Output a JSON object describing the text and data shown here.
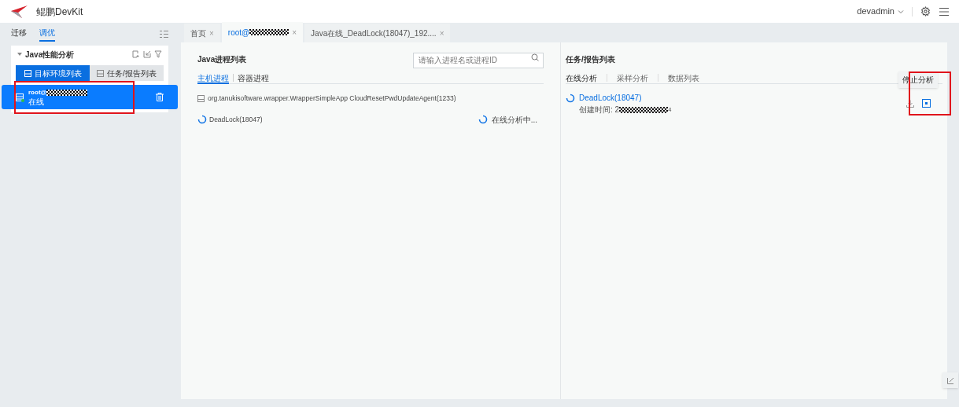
{
  "header": {
    "app_name": "鲲鹏DevKit",
    "user": "devadmin"
  },
  "sidebar": {
    "tabs": [
      {
        "label": "迁移",
        "selected": false
      },
      {
        "label": "调优",
        "selected": true
      }
    ],
    "section": {
      "title": "Java性能分析",
      "expanded": true
    },
    "views": [
      {
        "label": "目标环境列表",
        "selected": true
      },
      {
        "label": "任务/报告列表",
        "selected": false
      }
    ],
    "targets": [
      {
        "name": "root@",
        "status": "在线",
        "online": true,
        "selected": true
      }
    ]
  },
  "tabs": [
    {
      "label": "首页",
      "selected": false,
      "redacted": false,
      "close": "×"
    },
    {
      "label": "root@",
      "selected": true,
      "redacted": true,
      "close": "×"
    },
    {
      "label": "Java在线_DeadLock(18047)_192....",
      "selected": false,
      "redacted": false,
      "close": "×"
    }
  ],
  "process_panel": {
    "title": "Java进程列表",
    "search": {
      "placeholder": "请输入进程名或进程ID"
    },
    "tabs": [
      {
        "label": "主机进程",
        "selected": true
      },
      {
        "label": "容器进程",
        "selected": false
      }
    ],
    "processes": [
      {
        "kind": "static",
        "name": "org.tanukisoftware.wrapper.WrapperSimpleApp CloudResetPwdUpdateAgent(1233)"
      },
      {
        "kind": "analyzing",
        "name": "DeadLock(18047)",
        "status": "在线分析中..."
      }
    ]
  },
  "task_panel": {
    "title": "任务/报告列表",
    "tabs": [
      {
        "label": "在线分析",
        "selected": true
      },
      {
        "label": "采样分析",
        "selected": false
      },
      {
        "label": "数据列表",
        "selected": false
      }
    ],
    "tasks": [
      {
        "name": "DeadLock(18047)",
        "created_label": "创建时间: 2",
        "created_tail": "4",
        "tooltip": "停止分析"
      }
    ]
  }
}
